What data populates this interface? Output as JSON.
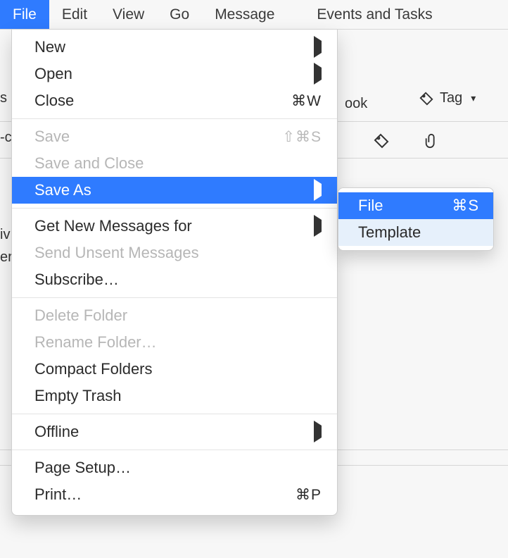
{
  "menubar": {
    "items": [
      {
        "label": "File",
        "active": true
      },
      {
        "label": "Edit"
      },
      {
        "label": "View"
      },
      {
        "label": "Go"
      },
      {
        "label": "Message"
      },
      {
        "label": "Events and Tasks"
      }
    ]
  },
  "toolbar": {
    "visible_text_behind": "ook",
    "tag_label": "Tag"
  },
  "left_edge_fragments": [
    "s",
    "-c",
    "iv",
    "er"
  ],
  "file_menu": {
    "groups": [
      [
        {
          "label": "New",
          "submenu": true
        },
        {
          "label": "Open",
          "submenu": true
        },
        {
          "label": "Close",
          "shortcut": "⌘W"
        }
      ],
      [
        {
          "label": "Save",
          "shortcut": "⇧⌘S",
          "disabled": true
        },
        {
          "label": "Save and Close",
          "disabled": true
        },
        {
          "label": "Save As",
          "submenu": true,
          "highlight": true
        }
      ],
      [
        {
          "label": "Get New Messages for",
          "submenu": true
        },
        {
          "label": "Send Unsent Messages",
          "disabled": true
        },
        {
          "label": "Subscribe…"
        }
      ],
      [
        {
          "label": "Delete Folder",
          "disabled": true
        },
        {
          "label": "Rename Folder…",
          "disabled": true
        },
        {
          "label": "Compact Folders"
        },
        {
          "label": "Empty Trash"
        }
      ],
      [
        {
          "label": "Offline",
          "submenu": true
        }
      ],
      [
        {
          "label": "Page Setup…"
        },
        {
          "label": "Print…",
          "shortcut": "⌘P"
        }
      ]
    ]
  },
  "save_as_submenu": {
    "items": [
      {
        "label": "File",
        "shortcut": "⌘S",
        "highlight": true
      },
      {
        "label": "Template"
      }
    ]
  }
}
